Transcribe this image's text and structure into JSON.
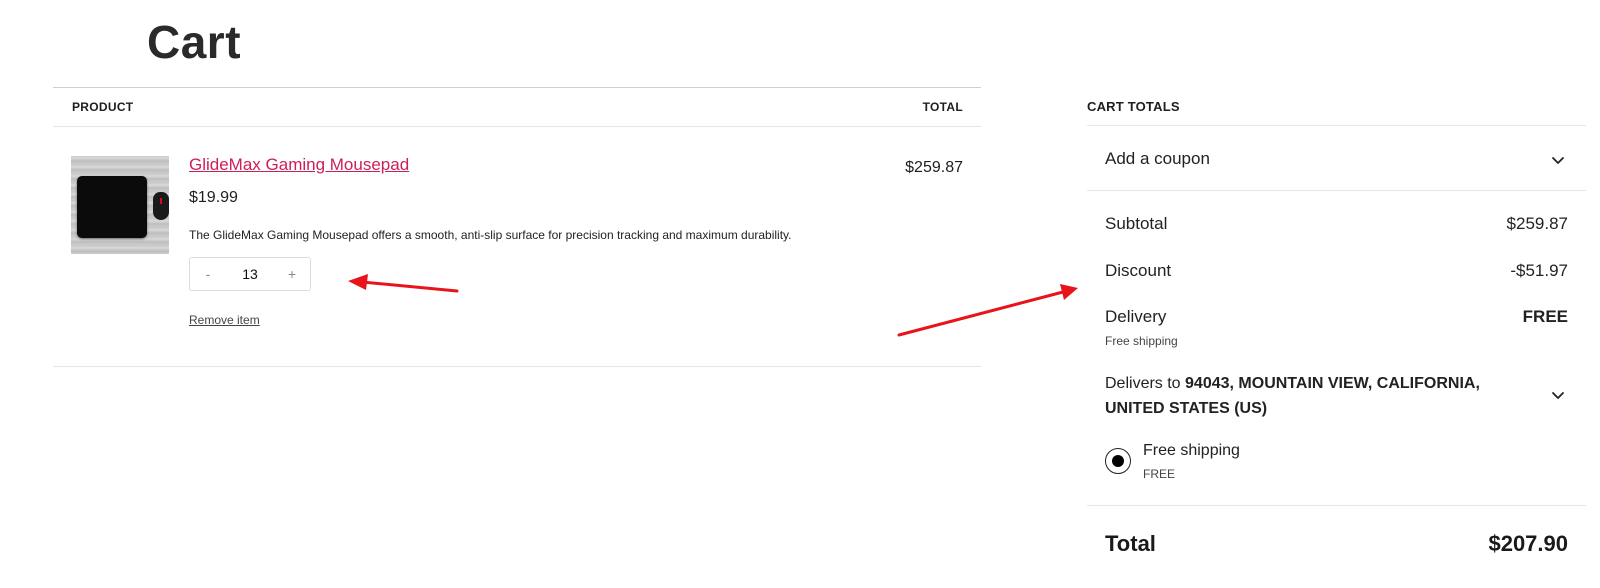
{
  "page": {
    "title": "Cart"
  },
  "cart_table": {
    "product_header": "PRODUCT",
    "total_header": "TOTAL",
    "items": [
      {
        "name": "GlideMax Gaming Mousepad",
        "price": "$19.99",
        "description": "The GlideMax Gaming Mousepad offers a smooth, anti-slip surface for precision tracking and maximum durability.",
        "quantity": "13",
        "decrement_label": "-",
        "increment_label": "+",
        "remove_label": "Remove item",
        "line_total": "$259.87",
        "image_icon": "mousepad-product-image"
      }
    ]
  },
  "totals": {
    "heading": "CART TOTALS",
    "coupon_label": "Add a coupon",
    "subtotal_label": "Subtotal",
    "subtotal_value": "$259.87",
    "discount_label": "Discount",
    "discount_value": "-$51.97",
    "delivery_label": "Delivery",
    "delivery_value": "FREE",
    "delivery_note": "Free shipping",
    "delivers_to_prefix": "Delivers to",
    "delivers_to_address_line1": "94043, MOUNTAIN VIEW, CALIFORNIA,",
    "delivers_to_address_line2": "UNITED STATES (US)",
    "shipping_option_label": "Free shipping",
    "shipping_option_price": "FREE",
    "total_label": "Total",
    "total_value": "$207.90"
  },
  "colors": {
    "product_link": "#cc1f56",
    "annotation_arrow": "#e8141b",
    "divider": "#e7e7e7"
  }
}
